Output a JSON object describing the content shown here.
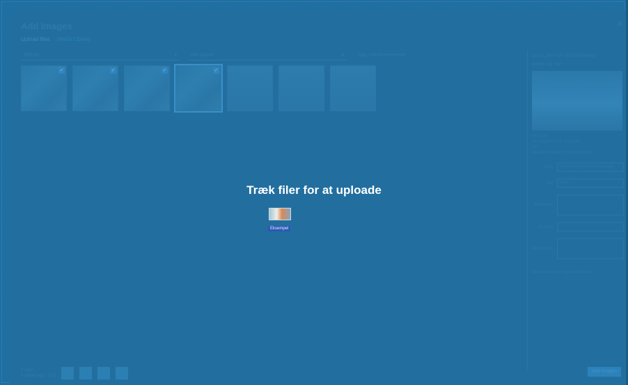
{
  "modal": {
    "title": "Add Images",
    "close_icon": "close-icon",
    "tabs": [
      "Upload files",
      "Media Library"
    ]
  },
  "filters": {
    "type": "Billeder",
    "date": "Alle datoer",
    "search_placeholder": "Søg i medieelementer"
  },
  "library": {
    "thumbnails": [
      {
        "selected": true
      },
      {
        "selected": true
      },
      {
        "selected": true
      },
      {
        "selected": true
      },
      {
        "selected": false
      },
      {
        "selected": false
      },
      {
        "selected": false
      }
    ]
  },
  "details": {
    "title": "DETALJER FOR VEDHÆFTNING",
    "size_label": "Billede stør",
    "size_value": "Stor",
    "filename": "hav1.jpg",
    "date": "25. august 2010, 3:51 PM",
    "dimensions": "840",
    "edit_link": "Rediger billede | Slet permanent",
    "url_label": "URL",
    "url_value": "https://example.com/hav1.jpg",
    "title_label": "Titel",
    "title_value": "hav1",
    "caption_label": "Billedtekst",
    "alt_label": "Alt-tekst",
    "description_label": "Beskrivelse",
    "required_note": "Beskrivelse, titel og alt-tekst skal *"
  },
  "footer": {
    "selected_count": "4 valgt",
    "actions": "Rediger valg · Ryd"
  },
  "insert_button": "Add Images",
  "drop_overlay": {
    "message": "Træk filer for at uploade",
    "drag_label": "Eksempel"
  }
}
